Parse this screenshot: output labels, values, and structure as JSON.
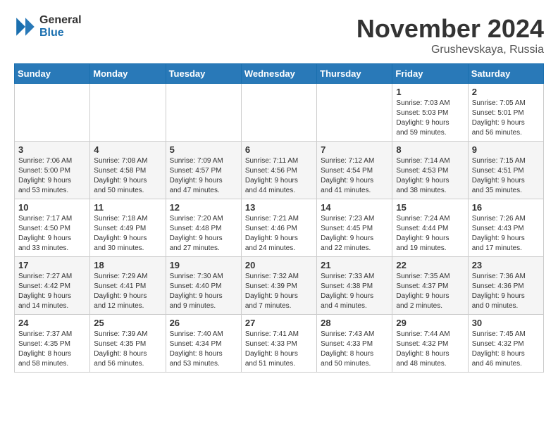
{
  "header": {
    "logo_general": "General",
    "logo_blue": "Blue",
    "month_year": "November 2024",
    "location": "Grushevskaya, Russia"
  },
  "weekdays": [
    "Sunday",
    "Monday",
    "Tuesday",
    "Wednesday",
    "Thursday",
    "Friday",
    "Saturday"
  ],
  "weeks": [
    [
      {
        "day": "",
        "info": ""
      },
      {
        "day": "",
        "info": ""
      },
      {
        "day": "",
        "info": ""
      },
      {
        "day": "",
        "info": ""
      },
      {
        "day": "",
        "info": ""
      },
      {
        "day": "1",
        "info": "Sunrise: 7:03 AM\nSunset: 5:03 PM\nDaylight: 9 hours\nand 59 minutes."
      },
      {
        "day": "2",
        "info": "Sunrise: 7:05 AM\nSunset: 5:01 PM\nDaylight: 9 hours\nand 56 minutes."
      }
    ],
    [
      {
        "day": "3",
        "info": "Sunrise: 7:06 AM\nSunset: 5:00 PM\nDaylight: 9 hours\nand 53 minutes."
      },
      {
        "day": "4",
        "info": "Sunrise: 7:08 AM\nSunset: 4:58 PM\nDaylight: 9 hours\nand 50 minutes."
      },
      {
        "day": "5",
        "info": "Sunrise: 7:09 AM\nSunset: 4:57 PM\nDaylight: 9 hours\nand 47 minutes."
      },
      {
        "day": "6",
        "info": "Sunrise: 7:11 AM\nSunset: 4:56 PM\nDaylight: 9 hours\nand 44 minutes."
      },
      {
        "day": "7",
        "info": "Sunrise: 7:12 AM\nSunset: 4:54 PM\nDaylight: 9 hours\nand 41 minutes."
      },
      {
        "day": "8",
        "info": "Sunrise: 7:14 AM\nSunset: 4:53 PM\nDaylight: 9 hours\nand 38 minutes."
      },
      {
        "day": "9",
        "info": "Sunrise: 7:15 AM\nSunset: 4:51 PM\nDaylight: 9 hours\nand 35 minutes."
      }
    ],
    [
      {
        "day": "10",
        "info": "Sunrise: 7:17 AM\nSunset: 4:50 PM\nDaylight: 9 hours\nand 33 minutes."
      },
      {
        "day": "11",
        "info": "Sunrise: 7:18 AM\nSunset: 4:49 PM\nDaylight: 9 hours\nand 30 minutes."
      },
      {
        "day": "12",
        "info": "Sunrise: 7:20 AM\nSunset: 4:48 PM\nDaylight: 9 hours\nand 27 minutes."
      },
      {
        "day": "13",
        "info": "Sunrise: 7:21 AM\nSunset: 4:46 PM\nDaylight: 9 hours\nand 24 minutes."
      },
      {
        "day": "14",
        "info": "Sunrise: 7:23 AM\nSunset: 4:45 PM\nDaylight: 9 hours\nand 22 minutes."
      },
      {
        "day": "15",
        "info": "Sunrise: 7:24 AM\nSunset: 4:44 PM\nDaylight: 9 hours\nand 19 minutes."
      },
      {
        "day": "16",
        "info": "Sunrise: 7:26 AM\nSunset: 4:43 PM\nDaylight: 9 hours\nand 17 minutes."
      }
    ],
    [
      {
        "day": "17",
        "info": "Sunrise: 7:27 AM\nSunset: 4:42 PM\nDaylight: 9 hours\nand 14 minutes."
      },
      {
        "day": "18",
        "info": "Sunrise: 7:29 AM\nSunset: 4:41 PM\nDaylight: 9 hours\nand 12 minutes."
      },
      {
        "day": "19",
        "info": "Sunrise: 7:30 AM\nSunset: 4:40 PM\nDaylight: 9 hours\nand 9 minutes."
      },
      {
        "day": "20",
        "info": "Sunrise: 7:32 AM\nSunset: 4:39 PM\nDaylight: 9 hours\nand 7 minutes."
      },
      {
        "day": "21",
        "info": "Sunrise: 7:33 AM\nSunset: 4:38 PM\nDaylight: 9 hours\nand 4 minutes."
      },
      {
        "day": "22",
        "info": "Sunrise: 7:35 AM\nSunset: 4:37 PM\nDaylight: 9 hours\nand 2 minutes."
      },
      {
        "day": "23",
        "info": "Sunrise: 7:36 AM\nSunset: 4:36 PM\nDaylight: 9 hours\nand 0 minutes."
      }
    ],
    [
      {
        "day": "24",
        "info": "Sunrise: 7:37 AM\nSunset: 4:35 PM\nDaylight: 8 hours\nand 58 minutes."
      },
      {
        "day": "25",
        "info": "Sunrise: 7:39 AM\nSunset: 4:35 PM\nDaylight: 8 hours\nand 56 minutes."
      },
      {
        "day": "26",
        "info": "Sunrise: 7:40 AM\nSunset: 4:34 PM\nDaylight: 8 hours\nand 53 minutes."
      },
      {
        "day": "27",
        "info": "Sunrise: 7:41 AM\nSunset: 4:33 PM\nDaylight: 8 hours\nand 51 minutes."
      },
      {
        "day": "28",
        "info": "Sunrise: 7:43 AM\nSunset: 4:33 PM\nDaylight: 8 hours\nand 50 minutes."
      },
      {
        "day": "29",
        "info": "Sunrise: 7:44 AM\nSunset: 4:32 PM\nDaylight: 8 hours\nand 48 minutes."
      },
      {
        "day": "30",
        "info": "Sunrise: 7:45 AM\nSunset: 4:32 PM\nDaylight: 8 hours\nand 46 minutes."
      }
    ]
  ]
}
